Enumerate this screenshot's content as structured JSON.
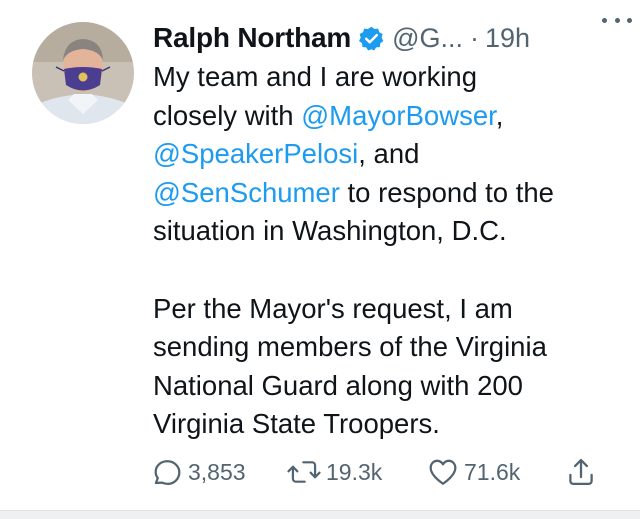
{
  "colors": {
    "text": "#0f1419",
    "secondary": "#536471",
    "link": "#1d9bf0"
  },
  "tweet": {
    "author": {
      "name": "Ralph Northam",
      "handle": "@G...",
      "separator": "·",
      "time": "19h",
      "verified_icon": "verified-badge-icon"
    },
    "body": {
      "line1": "My team and I are working",
      "line2_pre": "closely with ",
      "line2_mention": "@MayorBowser",
      "line2_post": ",",
      "line3_mention": "@SpeakerPelosi",
      "line3_post": ", and",
      "line4_mention": "@SenSchumer",
      "line4_post": " to respond to the",
      "line5": "situation in Washington, D.C.",
      "line6": "Per the Mayor's request, I am",
      "line7": "sending members of the Virginia",
      "line8": "National Guard along with 200",
      "line9": "Virginia State Troopers."
    },
    "actions": {
      "reply": {
        "icon": "reply-icon",
        "count": "3,853"
      },
      "retweet": {
        "icon": "retweet-icon",
        "count": "19.3k"
      },
      "like": {
        "icon": "like-icon",
        "count": "71.6k"
      },
      "share": {
        "icon": "share-icon"
      }
    }
  }
}
